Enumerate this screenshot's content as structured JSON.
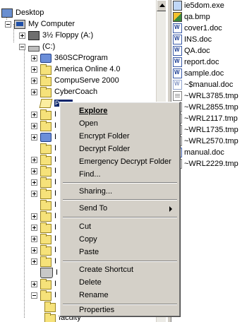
{
  "tree": {
    "desktop": "Desktop",
    "my_computer": "My Computer",
    "floppy": "3½ Floppy (A:)",
    "c_drive": "(C:)",
    "folders": [
      "360SCProgram",
      "America Online 4.0",
      "CompuServe 2000",
      "CyberCoach"
    ],
    "selected_folder": "Prnsp",
    "partial_items": [
      "I",
      "I",
      "I",
      "I",
      "I",
      "I",
      "I",
      "I",
      "I",
      "I",
      "I",
      "I",
      "I",
      "I",
      "I",
      "I",
      "I",
      "!",
      "faculty"
    ]
  },
  "files": [
    {
      "name": "ie5dom.exe",
      "type": "exe"
    },
    {
      "name": "qa.bmp",
      "type": "bmp"
    },
    {
      "name": "cover1.doc",
      "type": "doc"
    },
    {
      "name": "INS.doc",
      "type": "doc"
    },
    {
      "name": "QA.doc",
      "type": "doc"
    },
    {
      "name": "report.doc",
      "type": "doc"
    },
    {
      "name": "sample.doc",
      "type": "doc"
    },
    {
      "name": "~$manual.doc",
      "type": "doc-ghost"
    },
    {
      "name": "~WRL3785.tmp",
      "type": "tmp"
    },
    {
      "name": "~WRL2855.tmp",
      "type": "tmp"
    },
    {
      "name": "~WRL2117.tmp",
      "type": "tmp"
    },
    {
      "name": "~WRL1735.tmp",
      "type": "tmp"
    },
    {
      "name": "~WRL2570.tmp",
      "type": "tmp"
    },
    {
      "name": "manual.doc",
      "type": "doc"
    },
    {
      "name": "~WRL2229.tmp",
      "type": "tmp"
    }
  ],
  "context_menu": {
    "explore": "Explore",
    "open": "Open",
    "encrypt": "Encrypt Folder",
    "decrypt": "Decrypt Folder",
    "emergency": "Emergency Decrypt Folder",
    "find": "Find...",
    "sharing": "Sharing...",
    "send_to": "Send To",
    "cut": "Cut",
    "copy": "Copy",
    "paste": "Paste",
    "create_shortcut": "Create Shortcut",
    "delete": "Delete",
    "rename": "Rename",
    "properties": "Properties"
  },
  "colors": {
    "menu_bg": "#d4d0c8",
    "selection": "#0a246a",
    "folder": "#f6e27a"
  }
}
